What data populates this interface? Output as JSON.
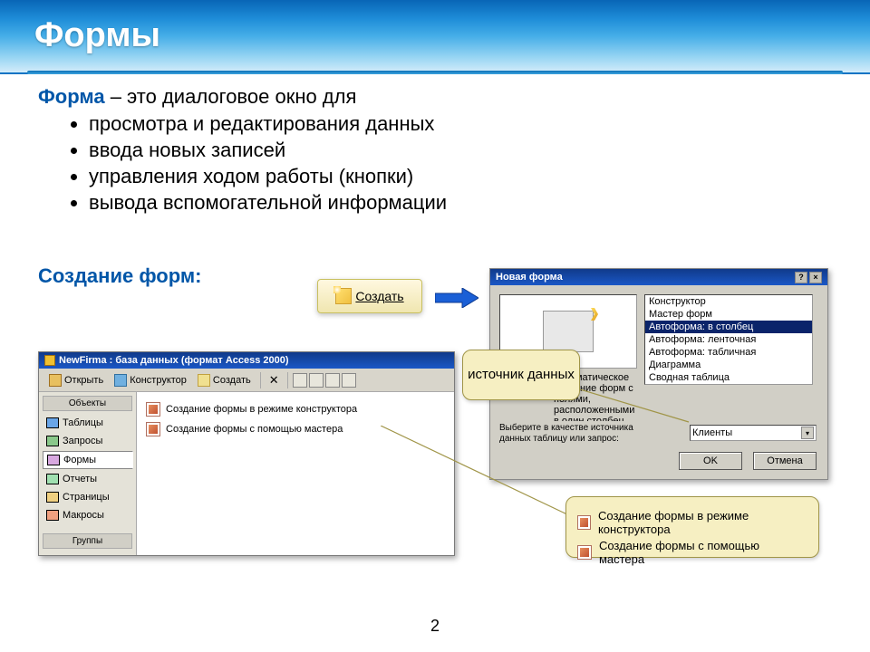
{
  "banner": {
    "title": "Формы"
  },
  "intro": {
    "term": "Форма",
    "rest": " – это диалоговое окно для",
    "bullets": [
      "просмотра и редактирования данных",
      "ввода новых записей",
      "управления ходом работы (кнопки)",
      "вывода вспомогательной информации"
    ]
  },
  "subheader": "Создание форм:",
  "create_button": {
    "label": "Создать"
  },
  "newform_dialog": {
    "title": "Новая форма",
    "options": [
      "Конструктор",
      "Мастер форм",
      "Автоформа: в столбец",
      "Автоформа: ленточная",
      "Автоформа: табличная",
      "Диаграмма",
      "Сводная таблица"
    ],
    "selected_index": 2,
    "desc_hidden": "Автоматическое создание форм с полями, расположенными в один столбец.",
    "src_label": "Выберите в качестве источника данных таблицу или запрос:",
    "combo_value": "Клиенты",
    "ok": "OK",
    "cancel": "Отмена"
  },
  "callout_source": "источник данных",
  "db_window": {
    "title": "NewFirma : база данных (формат Access 2000)",
    "toolbar": {
      "open": "Открыть",
      "design": "Конструктор",
      "create": "Создать"
    },
    "sidebar": {
      "group_top": "Объекты",
      "items": [
        "Таблицы",
        "Запросы",
        "Формы",
        "Отчеты",
        "Страницы",
        "Макросы"
      ],
      "selected_index": 2,
      "group_bottom": "Группы"
    },
    "main_items": [
      "Создание формы в режиме конструктора",
      "Создание формы с помощью мастера"
    ]
  },
  "callout2": {
    "items": [
      "Создание формы в режиме конструктора",
      "Создание формы с помощью мастера"
    ]
  },
  "page_number": "2",
  "colors": {
    "accent": "#0d6fb6",
    "callout_bg": "#f6efc2"
  }
}
